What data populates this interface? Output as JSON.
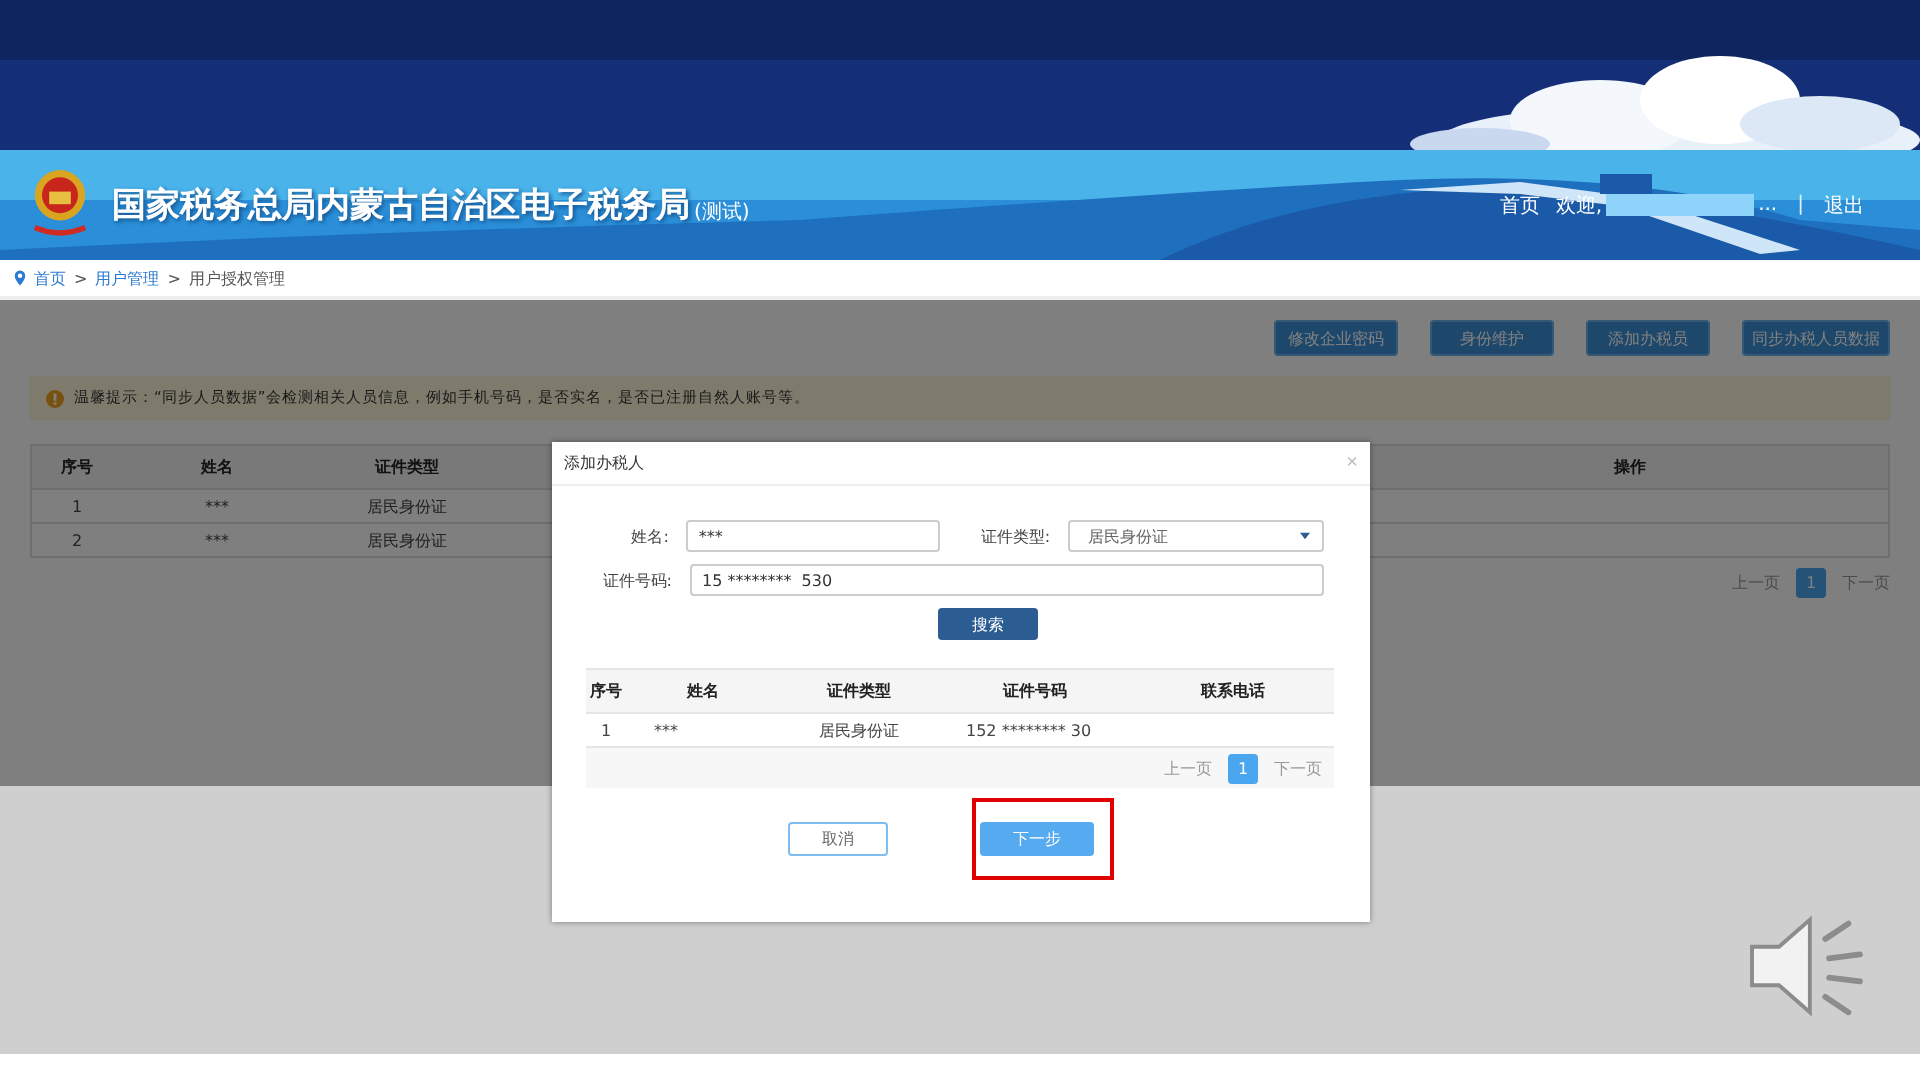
{
  "header": {
    "title": "国家税务总局内蒙古自治区电子税务局",
    "title_suffix": "(测试)",
    "home": "首页",
    "welcome": "欢迎,",
    "welcome_ellipsis": "...",
    "separator": "|",
    "logout": "退出"
  },
  "breadcrumb": [
    {
      "kind": "link",
      "label": "首页"
    },
    {
      "kind": "sep",
      "label": ">"
    },
    {
      "kind": "link",
      "label": "用户管理"
    },
    {
      "kind": "sep",
      "label": ">"
    },
    {
      "kind": "text",
      "label": "用户授权管理"
    }
  ],
  "toolbar": [
    "修改企业密码",
    "身份维护",
    "添加办税员",
    "同步办税人员数据"
  ],
  "notice": {
    "text": "温馨提示：“同步人员数据”会检测相关人员信息，例如手机号码，是否实名，是否已注册自然人账号等。"
  },
  "table": {
    "columns": [
      "序号",
      "姓名",
      "证件类型",
      "操作"
    ],
    "rows": [
      {
        "index": "1",
        "name": "***",
        "id_type": "居民身份证"
      },
      {
        "index": "2",
        "name": "***",
        "id_type": "居民身份证"
      }
    ]
  },
  "pagination": {
    "prev": "上一页",
    "pages": [
      {
        "label": "1",
        "selected": true
      }
    ],
    "next": "下一页"
  },
  "modal": {
    "title": "添加办税人",
    "close": "×",
    "form": {
      "name_label": "姓名:",
      "name_value": "***",
      "type_label": "证件类型:",
      "type_value": "居民身份证",
      "id_label": "证件号码:",
      "id_value": "15 ********  530"
    },
    "search_button": "搜索",
    "table": {
      "columns": [
        "序号",
        "姓名",
        "证件类型",
        "证件号码",
        "联系电话"
      ],
      "rows": [
        {
          "index": "1",
          "name": "***",
          "id_type": "居民身份证",
          "id_number": "152 ********  30"
        }
      ]
    },
    "pagination": {
      "prev": "上一页",
      "pages": [
        {
          "label": "1",
          "selected": true
        }
      ],
      "next": "下一页"
    },
    "cancel_button": "取消",
    "next_button": {
      "label": "下一步",
      "highlighted": true
    }
  }
}
